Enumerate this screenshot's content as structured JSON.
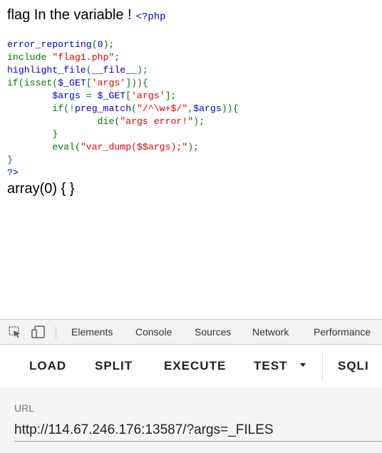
{
  "page": {
    "headline": "flag In the variable !",
    "php_open": "<?php",
    "code_lines": [
      [
        {
          "t": "error_reporting",
          "c": "default"
        },
        {
          "t": "(",
          "c": "keyword"
        },
        {
          "t": "0",
          "c": "default"
        },
        {
          "t": ");",
          "c": "keyword"
        }
      ],
      [
        {
          "t": "include ",
          "c": "keyword"
        },
        {
          "t": "\"flag1.php\"",
          "c": "string"
        },
        {
          "t": ";",
          "c": "keyword"
        }
      ],
      [
        {
          "t": "highlight_file",
          "c": "default"
        },
        {
          "t": "(",
          "c": "keyword"
        },
        {
          "t": "__file__",
          "c": "default"
        },
        {
          "t": ");",
          "c": "keyword"
        }
      ],
      [
        {
          "t": "if(isset(",
          "c": "keyword"
        },
        {
          "t": "$_GET",
          "c": "default"
        },
        {
          "t": "[",
          "c": "keyword"
        },
        {
          "t": "'args'",
          "c": "string"
        },
        {
          "t": "])){",
          "c": "keyword"
        }
      ],
      [
        {
          "t": "        ",
          "c": "default"
        },
        {
          "t": "$args ",
          "c": "default"
        },
        {
          "t": "= ",
          "c": "keyword"
        },
        {
          "t": "$_GET",
          "c": "default"
        },
        {
          "t": "[",
          "c": "keyword"
        },
        {
          "t": "'args'",
          "c": "string"
        },
        {
          "t": "];",
          "c": "keyword"
        }
      ],
      [
        {
          "t": "        if(!",
          "c": "keyword"
        },
        {
          "t": "preg_match",
          "c": "default"
        },
        {
          "t": "(",
          "c": "keyword"
        },
        {
          "t": "\"/^\\w+$/\"",
          "c": "string"
        },
        {
          "t": ",",
          "c": "keyword"
        },
        {
          "t": "$args",
          "c": "default"
        },
        {
          "t": ")){",
          "c": "keyword"
        }
      ],
      [
        {
          "t": "                die(",
          "c": "keyword"
        },
        {
          "t": "\"args error!\"",
          "c": "string"
        },
        {
          "t": ");",
          "c": "keyword"
        }
      ],
      [
        {
          "t": "        }",
          "c": "keyword"
        }
      ],
      [
        {
          "t": "        eval(",
          "c": "keyword"
        },
        {
          "t": "\"var_dump($$args);\"",
          "c": "string"
        },
        {
          "t": ");",
          "c": "keyword"
        }
      ],
      [
        {
          "t": "}",
          "c": "keyword"
        }
      ],
      [
        {
          "t": "?>",
          "c": "default"
        }
      ]
    ],
    "output": "array(0) { }"
  },
  "devtools": {
    "tabs": [
      "Elements",
      "Console",
      "Sources",
      "Network",
      "Performance"
    ],
    "icons": [
      "inspect-element-icon",
      "device-toolbar-icon"
    ]
  },
  "hackbar": {
    "buttons": {
      "load": "LOAD",
      "split": "SPLIT",
      "execute": "EXECUTE",
      "test": "TEST",
      "sqli": "SQLI"
    },
    "url_label": "URL",
    "url_value": "http://114.67.246.176:13587/?args=_FILES"
  }
}
